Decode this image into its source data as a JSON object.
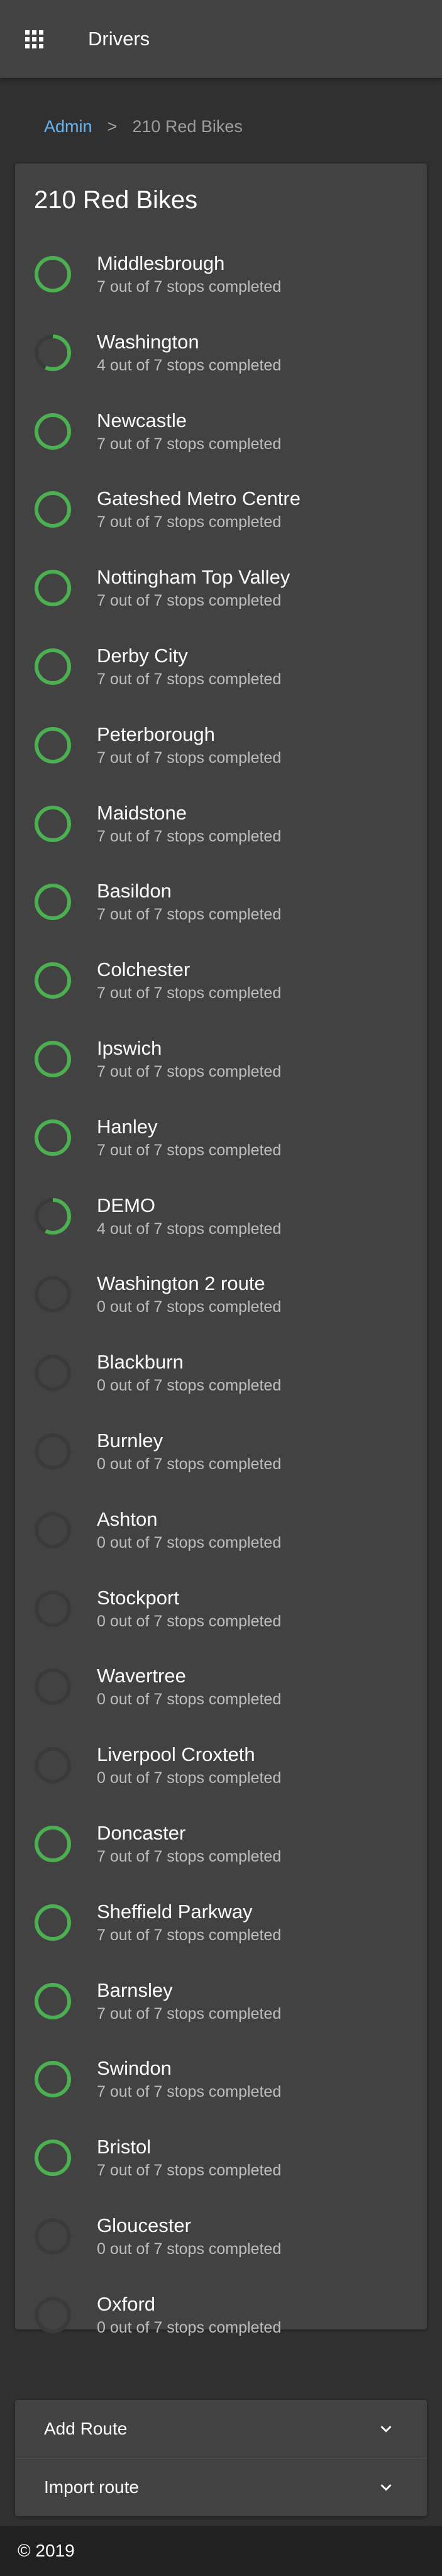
{
  "header": {
    "menu_icon": "apps-grid-icon",
    "title": "Drivers"
  },
  "breadcrumb": {
    "root": "Admin",
    "separator": ">",
    "current": "210 Red Bikes"
  },
  "card": {
    "title": "210 Red Bikes"
  },
  "colors": {
    "progress_complete": "#4caf50",
    "progress_track": "#3a3a3a",
    "link": "#64b5f6"
  },
  "routes": [
    {
      "name": "Middlesbrough",
      "status": "7 out of 7 stops completed",
      "completed": 7,
      "total": 7
    },
    {
      "name": "Washington",
      "status": "4 out of 7 stops completed",
      "completed": 4,
      "total": 7
    },
    {
      "name": "Newcastle",
      "status": "7 out of 7 stops completed",
      "completed": 7,
      "total": 7
    },
    {
      "name": "Gateshed Metro Centre",
      "status": "7 out of 7 stops completed",
      "completed": 7,
      "total": 7
    },
    {
      "name": "Nottingham Top Valley",
      "status": "7 out of 7 stops completed",
      "completed": 7,
      "total": 7
    },
    {
      "name": "Derby City",
      "status": "7 out of 7 stops completed",
      "completed": 7,
      "total": 7
    },
    {
      "name": "Peterborough",
      "status": "7 out of 7 stops completed",
      "completed": 7,
      "total": 7
    },
    {
      "name": "Maidstone",
      "status": "7 out of 7 stops completed",
      "completed": 7,
      "total": 7
    },
    {
      "name": "Basildon",
      "status": "7 out of 7 stops completed",
      "completed": 7,
      "total": 7
    },
    {
      "name": "Colchester",
      "status": "7 out of 7 stops completed",
      "completed": 7,
      "total": 7
    },
    {
      "name": "Ipswich",
      "status": "7 out of 7 stops completed",
      "completed": 7,
      "total": 7
    },
    {
      "name": "Hanley",
      "status": "7 out of 7 stops completed",
      "completed": 7,
      "total": 7
    },
    {
      "name": "DEMO",
      "status": "4 out of 7 stops completed",
      "completed": 4,
      "total": 7
    },
    {
      "name": "Washington 2 route",
      "status": "0 out of 7 stops completed",
      "completed": 0,
      "total": 7
    },
    {
      "name": "Blackburn",
      "status": "0 out of 7 stops completed",
      "completed": 0,
      "total": 7
    },
    {
      "name": "Burnley",
      "status": "0 out of 7 stops completed",
      "completed": 0,
      "total": 7
    },
    {
      "name": "Ashton",
      "status": "0 out of 7 stops completed",
      "completed": 0,
      "total": 7
    },
    {
      "name": "Stockport",
      "status": "0 out of 7 stops completed",
      "completed": 0,
      "total": 7
    },
    {
      "name": "Wavertree",
      "status": "0 out of 7 stops completed",
      "completed": 0,
      "total": 7
    },
    {
      "name": "Liverpool Croxteth",
      "status": "0 out of 7 stops completed",
      "completed": 0,
      "total": 7
    },
    {
      "name": "Doncaster",
      "status": "7 out of 7 stops completed",
      "completed": 7,
      "total": 7
    },
    {
      "name": "Sheffield Parkway",
      "status": "7 out of 7 stops completed",
      "completed": 7,
      "total": 7
    },
    {
      "name": "Barnsley",
      "status": "7 out of 7 stops completed",
      "completed": 7,
      "total": 7
    },
    {
      "name": "Swindon",
      "status": "7 out of 7 stops completed",
      "completed": 7,
      "total": 7
    },
    {
      "name": "Bristol",
      "status": "7 out of 7 stops completed",
      "completed": 7,
      "total": 7
    },
    {
      "name": "Gloucester",
      "status": "0 out of 7 stops completed",
      "completed": 0,
      "total": 7
    },
    {
      "name": "Oxford",
      "status": "0 out of 7 stops completed",
      "completed": 0,
      "total": 7
    }
  ],
  "actions": {
    "add_route_label": "Add Route",
    "import_route_label": "Import route",
    "expand_icon": "chevron-down-icon"
  },
  "footer": {
    "copyright": "© 2019"
  }
}
